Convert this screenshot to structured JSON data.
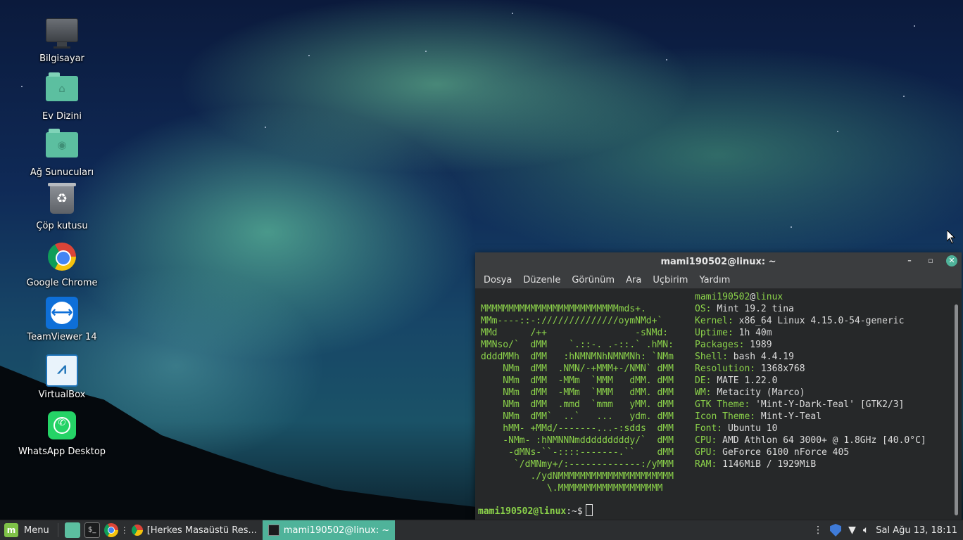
{
  "desktop": {
    "icons": [
      {
        "label": "Bilgisayar",
        "icon": "computer-icon"
      },
      {
        "label": "Ev Dizini",
        "icon": "home-folder-icon"
      },
      {
        "label": "Ağ Sunucuları",
        "icon": "network-folder-icon"
      },
      {
        "label": "Çöp kutusu",
        "icon": "trash-icon"
      },
      {
        "label": "Google Chrome",
        "icon": "chrome-icon"
      },
      {
        "label": "TeamViewer 14",
        "icon": "teamviewer-icon"
      },
      {
        "label": "VirtualBox",
        "icon": "virtualbox-icon"
      },
      {
        "label": "WhatsApp Desktop",
        "icon": "whatsapp-icon"
      }
    ]
  },
  "terminal": {
    "title": "mami190502@linux: ~",
    "menu": [
      "Dosya",
      "Düzenle",
      "Görünüm",
      "Ara",
      "Uçbirim",
      "Yardım"
    ],
    "logo": "MMMMMMMMMMMMMMMMMMMMMMMMMmds+.\nMMm----::-://////////////oymNMd+`\nMMd      /++                -sNMd:\nMMNso/`  dMM    `.::-. .-::.` .hMN:\nddddMMh  dMM   :hNMNMNhNMNMNh: `NMm\n    NMm  dMM  .NMN/-+MMM+-/NMN` dMM\n    NMm  dMM  -MMm  `MMM   dMM. dMM\n    NMm  dMM  -MMm  `MMM   dMM. dMM\n    NMm  dMM  .mmd  `mmm   yMM. dMM\n    NMm  dMM`  ..`   ...   ydm. dMM\n    hMM- +MMd/-------...-:sdds  dMM\n    -NMm- :hNMNNNmdddddddddy/`  dMM\n     -dMNs-``-::::-------.``    dMM\n      `/dMNmy+/:-------------:/yMMM\n         ./ydNMMMMMMMMMMMMMMMMMMMMM\n            \\.MMMMMMMMMMMMMMMMMMM",
    "user_host": {
      "user": "mami190502",
      "at": "@",
      "host": "linux"
    },
    "info": [
      {
        "key": "OS:",
        "value": "Mint 19.2 tina"
      },
      {
        "key": "Kernel:",
        "value": "x86_64 Linux 4.15.0-54-generic"
      },
      {
        "key": "Uptime:",
        "value": "1h 40m"
      },
      {
        "key": "Packages:",
        "value": "1989"
      },
      {
        "key": "Shell:",
        "value": "bash 4.4.19"
      },
      {
        "key": "Resolution:",
        "value": "1368x768"
      },
      {
        "key": "DE:",
        "value": "MATE 1.22.0"
      },
      {
        "key": "WM:",
        "value": "Metacity (Marco)"
      },
      {
        "key": "GTK Theme:",
        "value": "'Mint-Y-Dark-Teal' [GTK2/3]"
      },
      {
        "key": "Icon Theme:",
        "value": "Mint-Y-Teal"
      },
      {
        "key": "Font:",
        "value": "Ubuntu 10"
      },
      {
        "key": "CPU:",
        "value": "AMD Athlon 64 3000+ @ 1.8GHz [40.0°C]"
      },
      {
        "key": "GPU:",
        "value": "GeForce 6100 nForce 405"
      },
      {
        "key": "RAM:",
        "value": "1146MiB / 1929MiB"
      }
    ],
    "prompt": {
      "user_host": "mami190502@linux",
      "path": ":~$"
    }
  },
  "taskbar": {
    "menu_label": "Menu",
    "tasks": [
      {
        "label": "[Herkes Masaüstü Res...",
        "icon": "chrome-icon",
        "active": false
      },
      {
        "label": "mami190502@linux: ~",
        "icon": "terminal-icon",
        "active": true
      }
    ],
    "clock": "Sal Ağu 13, 18:11"
  },
  "colors": {
    "accent": "#4fb39a",
    "terminal_green": "#8bd24a",
    "panel": "#2c2e30"
  }
}
